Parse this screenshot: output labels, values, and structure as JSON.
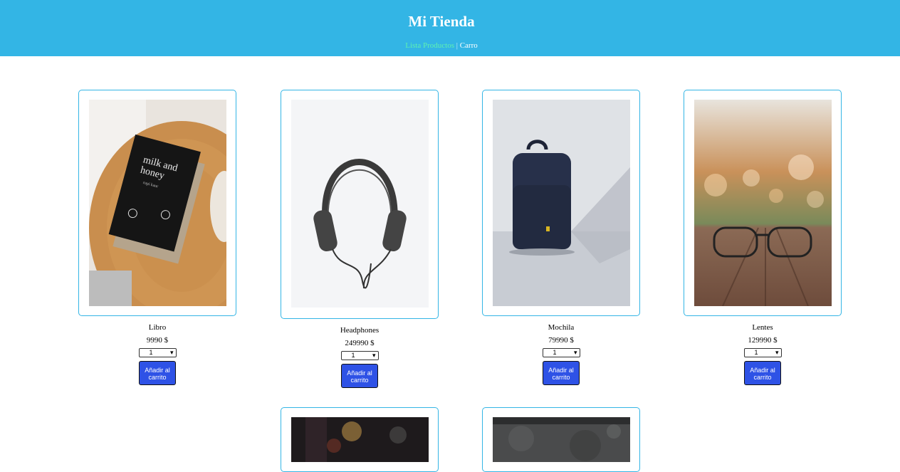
{
  "header": {
    "title": "Mi Tienda",
    "nav": {
      "products_label": "Lista Productos",
      "separator": "|",
      "cart_label": "Carro"
    },
    "colors": {
      "background": "#33b5e5",
      "products_link": "#5ef2b0"
    }
  },
  "products": [
    {
      "name": "Libro",
      "price": "9990 $",
      "qty": "1",
      "button": "Añadir al carrito",
      "image": "book-photo"
    },
    {
      "name": "Headphones",
      "price": "249990 $",
      "qty": "1",
      "button": "Añadir al carrito",
      "image": "headphones-photo"
    },
    {
      "name": "Mochila",
      "price": "79990 $",
      "qty": "1",
      "button": "Añadir al carrito",
      "image": "backpack-photo"
    },
    {
      "name": "Lentes",
      "price": "129990 $",
      "qty": "1",
      "button": "Añadir al carrito",
      "image": "glasses-photo"
    },
    {
      "image": "bokeh-photo"
    },
    {
      "image": "concrete-wall-photo"
    }
  ],
  "button_color": "#2e52e6"
}
